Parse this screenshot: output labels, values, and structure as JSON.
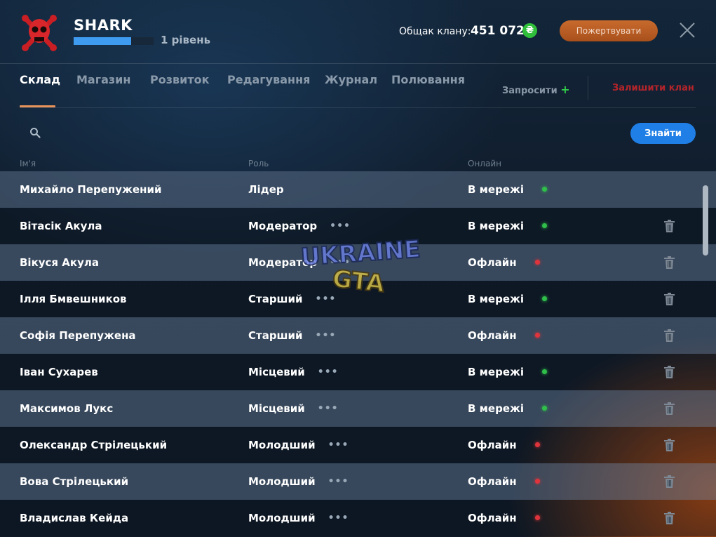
{
  "header": {
    "clan_name": "SHARK",
    "xp_progress": 0.72,
    "level_label": "1 рівень",
    "balance_label": "Общак клану:",
    "balance_value": "451 072",
    "currency_symbol": "₴",
    "donate_label": "Пожертвувати"
  },
  "tabs": [
    {
      "label": "Склад",
      "active": true
    },
    {
      "label": "Магазин",
      "active": false
    },
    {
      "label": "Розвиток",
      "active": false
    },
    {
      "label": "Редагування",
      "active": false
    },
    {
      "label": "Журнал",
      "active": false
    },
    {
      "label": "Полювання",
      "active": false
    }
  ],
  "actions": {
    "invite_label": "Запросити",
    "invite_plus": "+",
    "leave_label": "Залишити клан"
  },
  "search": {
    "placeholder": "",
    "button_label": "Знайти"
  },
  "table": {
    "headers": {
      "name": "Ім'я",
      "role": "Роль",
      "online": "Онлайн"
    },
    "rows": [
      {
        "name": "Михайло Перепужений",
        "role": "Лідер",
        "status": "В мережі",
        "online": true,
        "menu": false,
        "delete": false
      },
      {
        "name": "Вітасік Акула",
        "role": "Модератор",
        "status": "В мережі",
        "online": true,
        "menu": true,
        "delete": true
      },
      {
        "name": "Вікуся Акула",
        "role": "Модератор",
        "status": "Офлайн",
        "online": false,
        "menu": true,
        "delete": true
      },
      {
        "name": "Ілля Бмвешников",
        "role": "Старший",
        "status": "В мережі",
        "online": true,
        "menu": true,
        "delete": true
      },
      {
        "name": "Софія Перепужена",
        "role": "Старший",
        "status": "Офлайн",
        "online": false,
        "menu": true,
        "delete": true
      },
      {
        "name": "Іван Сухарев",
        "role": "Місцевий",
        "status": "В мережі",
        "online": true,
        "menu": true,
        "delete": true
      },
      {
        "name": "Максимов Лукс",
        "role": "Місцевий",
        "status": "В мережі",
        "online": true,
        "menu": true,
        "delete": true
      },
      {
        "name": "Олександр Стрілецький",
        "role": "Молодший",
        "status": "Офлайн",
        "online": false,
        "menu": true,
        "delete": true
      },
      {
        "name": "Вова Стрілецький",
        "role": "Молодший",
        "status": "Офлайн",
        "online": false,
        "menu": true,
        "delete": true
      },
      {
        "name": "Владислав Кейда",
        "role": "Молодший",
        "status": "Офлайн",
        "online": false,
        "menu": true,
        "delete": true
      }
    ]
  },
  "icons": {
    "menu_dots": "•••",
    "search": "search-icon",
    "close": "close-icon",
    "trash": "trash-icon"
  },
  "colors": {
    "accent": "#1f7fe6",
    "online": "#2fbf4a",
    "offline": "#e0343c",
    "leave": "#b5242a",
    "donate": "#b85a22"
  }
}
